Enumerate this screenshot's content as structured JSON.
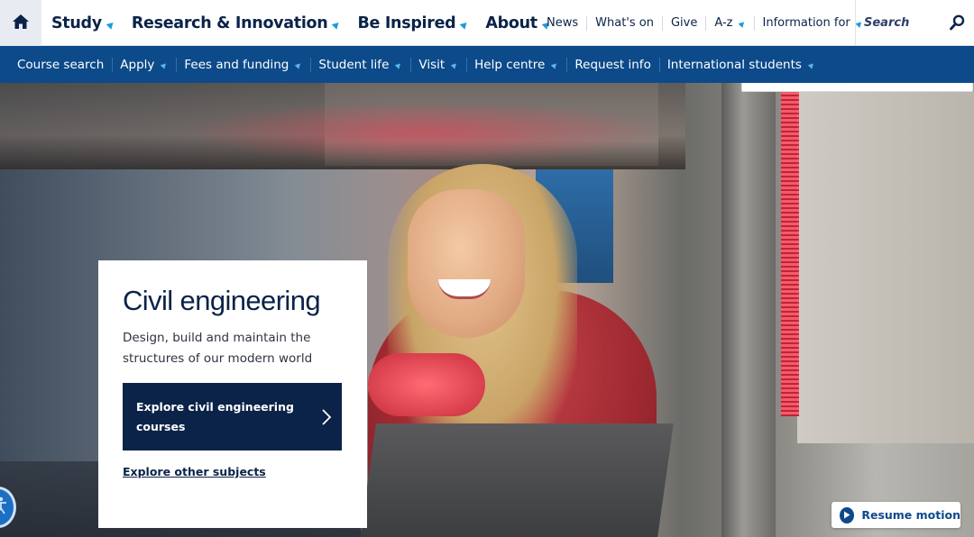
{
  "header": {
    "primary_nav": [
      {
        "label": "Study",
        "has_menu": true
      },
      {
        "label": "Research & Innovation",
        "has_menu": true
      },
      {
        "label": "Be Inspired",
        "has_menu": true
      },
      {
        "label": "About",
        "has_menu": true
      }
    ],
    "utility_nav": [
      {
        "label": "News",
        "has_menu": false
      },
      {
        "label": "What's on",
        "has_menu": false
      },
      {
        "label": "Give",
        "has_menu": false
      },
      {
        "label": "A-z",
        "has_menu": true
      },
      {
        "label": "Information for",
        "has_menu": true
      }
    ],
    "search": {
      "placeholder": "Search"
    }
  },
  "subnav": [
    {
      "label": "Course search",
      "has_menu": false
    },
    {
      "label": "Apply",
      "has_menu": true
    },
    {
      "label": "Fees and funding",
      "has_menu": true
    },
    {
      "label": "Student life",
      "has_menu": true
    },
    {
      "label": "Visit",
      "has_menu": true
    },
    {
      "label": "Help centre",
      "has_menu": true
    },
    {
      "label": "Request info",
      "has_menu": false
    },
    {
      "label": "International students",
      "has_menu": true
    }
  ],
  "hero": {
    "card": {
      "title": "Civil engineering",
      "description": "Design, build and maintain the structures of our modern world",
      "cta_label": "Explore civil engineering courses",
      "secondary_link": "Explore other subjects"
    },
    "resume_button": "Resume motion"
  },
  "icons": {
    "home": "home-icon",
    "search": "search-icon",
    "menu_indicator": "triangle-icon",
    "cta": "chevron-right-icon",
    "play": "play-icon",
    "accessibility": "accessibility-icon"
  },
  "colors": {
    "navy": "#0b2348",
    "subnav_blue": "#0c4a8a",
    "accent_cyan": "#1c9cd8",
    "white": "#ffffff"
  }
}
